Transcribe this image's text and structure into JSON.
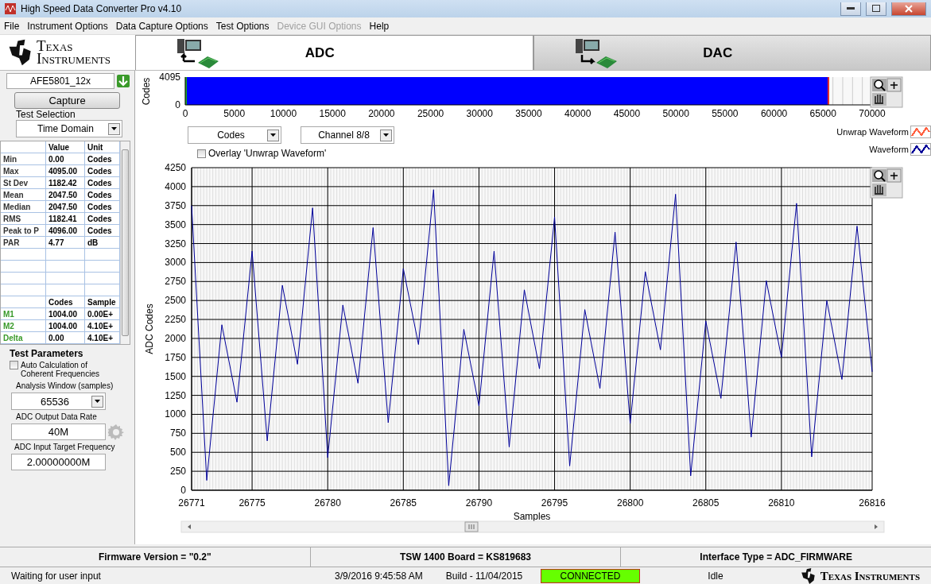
{
  "window": {
    "title": "High Speed Data Converter Pro v4.10"
  },
  "menu": [
    {
      "label": "File",
      "disabled": false
    },
    {
      "label": "Instrument Options",
      "disabled": false
    },
    {
      "label": "Data Capture Options",
      "disabled": false
    },
    {
      "label": "Test Options",
      "disabled": false
    },
    {
      "label": "Device GUI Options",
      "disabled": true
    },
    {
      "label": "Help",
      "disabled": false
    }
  ],
  "logo": {
    "text": "Texas Instruments"
  },
  "tabs": [
    {
      "label": "ADC",
      "selected": true
    },
    {
      "label": "DAC",
      "selected": false
    }
  ],
  "device": {
    "value": "AFE5801_12x"
  },
  "capture_button": "Capture",
  "test_selection": {
    "label": "Test Selection",
    "value": "Time Domain"
  },
  "stats_table": {
    "columns": [
      "Value",
      "Unit"
    ],
    "rows": [
      {
        "name": "Min",
        "value": "0.00",
        "unit": "Codes"
      },
      {
        "name": "Max",
        "value": "4095.00",
        "unit": "Codes"
      },
      {
        "name": "St Dev",
        "value": "1182.42",
        "unit": "Codes"
      },
      {
        "name": "Mean",
        "value": "2047.50",
        "unit": "Codes"
      },
      {
        "name": "Median",
        "value": "2047.50",
        "unit": "Codes"
      },
      {
        "name": "RMS",
        "value": "1182.41",
        "unit": "Codes"
      },
      {
        "name": "Peak to P",
        "value": "4096.00",
        "unit": "Codes"
      },
      {
        "name": "PAR",
        "value": "4.77",
        "unit": "dB"
      }
    ]
  },
  "markers_table": {
    "columns": [
      "Codes",
      "Sample"
    ],
    "rows": [
      {
        "name": "M1",
        "codes": "1004.00",
        "sample": "0.00E+"
      },
      {
        "name": "M2",
        "codes": "1004.00",
        "sample": "4.10E+"
      },
      {
        "name": "Delta",
        "codes": "0.00",
        "sample": "4.10E+"
      }
    ]
  },
  "test_parameters": {
    "title": "Test Parameters",
    "auto_calc": {
      "label": "Auto Calculation of Coherent Frequencies",
      "checked": false
    },
    "analysis_window": {
      "label": "Analysis Window (samples)",
      "value": "65536"
    },
    "output_rate": {
      "label": "ADC Output Data Rate",
      "value": "40M"
    },
    "input_frequency": {
      "label": "ADC Input Target Frequency",
      "value": "2.00000000M"
    }
  },
  "overview": {
    "ylabel": "Codes",
    "yticks": [
      "4095",
      "0"
    ],
    "xticks": [
      "0",
      "5000",
      "10000",
      "15000",
      "20000",
      "25000",
      "30000",
      "35000",
      "40000",
      "45000",
      "50000",
      "55000",
      "60000",
      "65000",
      "70000"
    ]
  },
  "unit_select": {
    "value": "Codes"
  },
  "channel_select": {
    "value": "Channel 8/8"
  },
  "overlay": {
    "label": "Overlay 'Unwrap Waveform'",
    "checked": false
  },
  "legend": [
    {
      "name": "Unwrap Waveform",
      "color": "#ff6040"
    },
    {
      "name": "Waveform",
      "color": "#000099"
    }
  ],
  "chart": {
    "chart_data": {
      "type": "line",
      "xlabel": "Samples",
      "ylabel": "ADC Codes",
      "x": [
        26771,
        26772,
        26773,
        26774,
        26775,
        26776,
        26777,
        26778,
        26779,
        26780,
        26781,
        26782,
        26783,
        26784,
        26785,
        26786,
        26787,
        26788,
        26789,
        26790,
        26791,
        26792,
        26793,
        26794,
        26795,
        26796,
        26797,
        26798,
        26799,
        26800,
        26801,
        26802,
        26803,
        26804,
        26805,
        26806,
        26807,
        26808,
        26809,
        26810,
        26811,
        26812,
        26813,
        26814,
        26815,
        26816
      ],
      "series": [
        {
          "color": "#000099",
          "values": [
            3750,
            130,
            2180,
            1160,
            3150,
            650,
            2700,
            1660,
            3720,
            430,
            2440,
            1410,
            3460,
            890,
            2920,
            1920,
            3960,
            60,
            2120,
            1110,
            3150,
            570,
            2640,
            1600,
            3600,
            320,
            2380,
            1340,
            3400,
            880,
            2880,
            1850,
            3900,
            190,
            2230,
            1210,
            3270,
            700,
            2760,
            1750,
            3780,
            440,
            2500,
            1460,
            3480,
            1560
          ]
        }
      ],
      "xlim": [
        26771,
        26816
      ],
      "ylim": [
        0,
        4250
      ],
      "grid": true,
      "xticks": [
        26771,
        26775,
        26780,
        26785,
        26790,
        26795,
        26800,
        26805,
        26810,
        26816
      ],
      "yticks": [
        0,
        250,
        500,
        750,
        1000,
        1250,
        1500,
        1750,
        2000,
        2250,
        2500,
        2750,
        3000,
        3250,
        3500,
        3750,
        4000,
        4250
      ]
    }
  },
  "status_bar": {
    "firmware": "Firmware Version = \"0.2\"",
    "board": "TSW 1400 Board = KS819683",
    "interface": "Interface Type = ADC_FIRMWARE",
    "message": "Waiting for user input",
    "datetime": "3/9/2016 9:45:58 AM",
    "build": "Build  - 11/04/2015",
    "connection": "CONNECTED",
    "state": "Idle",
    "logo": "Texas Instruments"
  }
}
